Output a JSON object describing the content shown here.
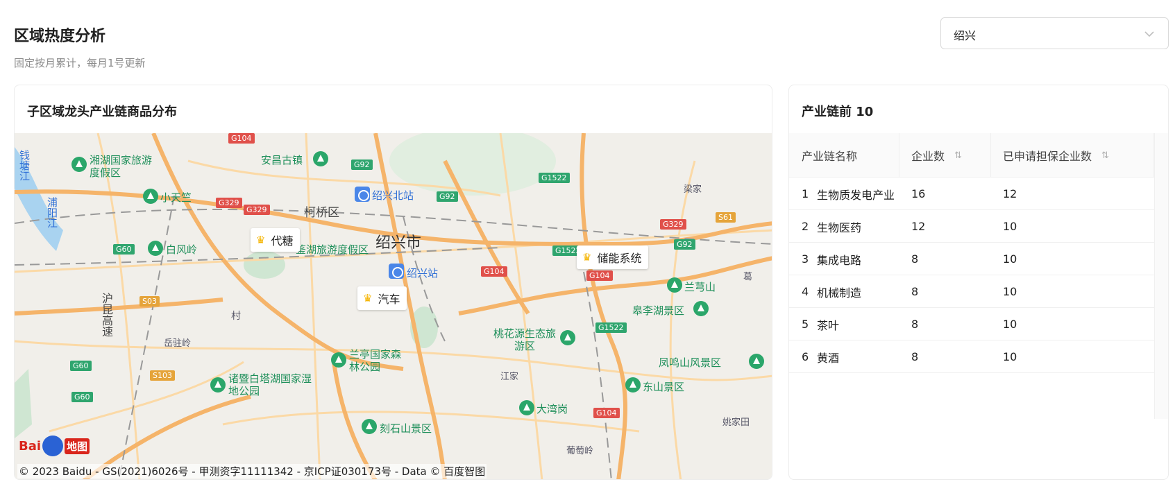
{
  "header": {
    "title": "区域热度分析",
    "subtitle": "固定按月累计，每月1号更新",
    "region_select": {
      "value": "绍兴"
    }
  },
  "map_card": {
    "title": "子区域龙头产业链商品分布",
    "markers": [
      {
        "label": "代糖"
      },
      {
        "label": "储能系统"
      },
      {
        "label": "汽车"
      }
    ],
    "place_labels": {
      "city": "绍兴市",
      "keqiao": "柯桥区",
      "anchang": "安昌古镇",
      "xianghu": "湘湖国家旅游度假区",
      "xiaotianzhu": "小天竺",
      "baifengling": "白风岭",
      "shaoxing_north": "绍兴北站",
      "shaoxing_station": "绍兴站",
      "jianhu": "鉴湖旅游度假区",
      "taohuayuan": "桃花源生态旅游区",
      "lanting": "兰亭国家森林公园",
      "zhuji": "诸暨白塔湖国家湿地公园",
      "keshishan": "刻石山景区",
      "dawangang": "大湾岗",
      "dongshan": "东山景区",
      "fengmingshan": "凤鸣山风景区",
      "gaolihu": "皋李湖景区",
      "lanyinshan": "兰芎山",
      "liangjia": "梁家",
      "yaojiatian": "姚家田",
      "jiangjia": "江家",
      "yuezhuling": "岳驻岭",
      "putaoling": "葡萄岭",
      "huhang": "沪昆高速",
      "qiantang": "钱塘江",
      "puyang": "浦阳江",
      "ge": "葛",
      "cun": "村"
    },
    "road_badges": [
      "G104",
      "G92",
      "G1522",
      "G329",
      "G329",
      "G92",
      "G60",
      "S03",
      "G1522",
      "G104",
      "G104",
      "G329",
      "S61",
      "G92",
      "G1522",
      "G60",
      "S103",
      "G60",
      "G104"
    ],
    "baidu_logo": {
      "text": "Bai",
      "map_text": "地图"
    },
    "copyright": "© 2023 Baidu - GS(2021)6026号 - 甲测资字11111342 - 京ICP证030173号 - Data © 百度智图"
  },
  "table_card": {
    "title": "产业链前 10",
    "columns": [
      "产业链名称",
      "企业数",
      "已申请担保企业数"
    ],
    "sort_icon": "sort-icon",
    "rows": [
      {
        "rank": "1",
        "name": "生物质发电产业",
        "companies": "16",
        "guaranteed": "12"
      },
      {
        "rank": "2",
        "name": "生物医药",
        "companies": "12",
        "guaranteed": "10"
      },
      {
        "rank": "3",
        "name": "集成电路",
        "companies": "8",
        "guaranteed": "10"
      },
      {
        "rank": "4",
        "name": "机械制造",
        "companies": "8",
        "guaranteed": "10"
      },
      {
        "rank": "5",
        "name": "茶叶",
        "companies": "8",
        "guaranteed": "10"
      },
      {
        "rank": "6",
        "name": "黄酒",
        "companies": "8",
        "guaranteed": "10"
      }
    ]
  },
  "colors": {
    "map_bg": "#f1efea",
    "road_major": "#f5b46a",
    "road_minor": "#fbd9a6",
    "green_poi": "#2ba66a",
    "crown": "#f5b400"
  }
}
